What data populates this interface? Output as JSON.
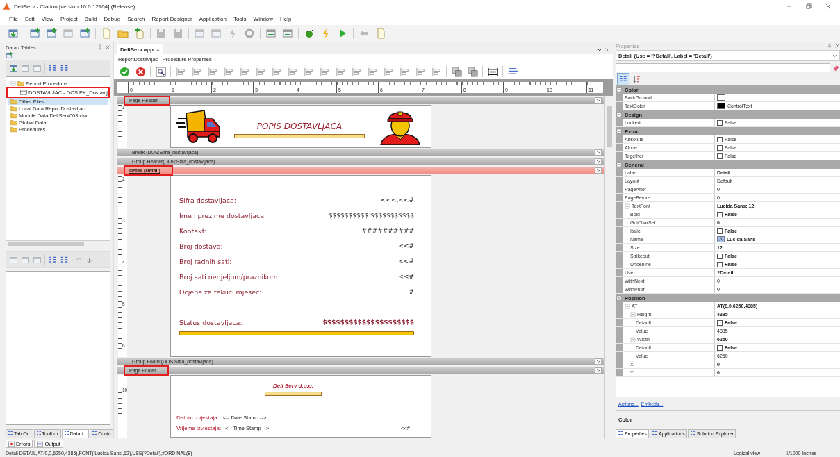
{
  "window": {
    "title": "DeliServ - Clarion [version 10.0.12104] (Release)"
  },
  "menu": [
    "File",
    "Edit",
    "View",
    "Project",
    "Build",
    "Debug",
    "Search",
    "Report Designer",
    "Application",
    "Tools",
    "Window",
    "Help"
  ],
  "data_panel": {
    "title": "Data / Tables",
    "tree": [
      {
        "label": "Report Procedure",
        "expanded": true,
        "selected": false,
        "highlighted": false,
        "children": [
          {
            "label": "DOSTAVLJAC - DOS:PK_Dostavlj",
            "selected": false,
            "highlighted": true
          }
        ]
      },
      {
        "label": "Other Files",
        "selected": true,
        "highlighted": false
      },
      {
        "label": "Local Data ReportDostavljac",
        "selected": false,
        "highlighted": false
      },
      {
        "label": "Module Data DeliServ003.clw",
        "selected": false,
        "highlighted": false
      },
      {
        "label": "Global Data",
        "selected": false,
        "highlighted": false
      },
      {
        "label": "Procedures",
        "selected": false,
        "highlighted": false
      }
    ],
    "tabs": [
      {
        "label": "Tab Or..",
        "selected": false
      },
      {
        "label": "Toolbox",
        "selected": false
      },
      {
        "label": "Data /...",
        "selected": true
      },
      {
        "label": "Contr...",
        "selected": false
      }
    ]
  },
  "document": {
    "tab": {
      "label": "DeliServ.app",
      "close": "×"
    },
    "subtitle": "ReportDostavljac - Procedure Properties",
    "ruler": [
      "0",
      "1",
      "2",
      "3",
      "4",
      "5",
      "6",
      "7",
      "8",
      "9",
      "10",
      "11"
    ],
    "sections": [
      {
        "band": {
          "label": "Page Header",
          "selected": false,
          "highlighted": true
        },
        "content": {
          "kind": "header",
          "ruler": [
            "1"
          ],
          "title": "POPIS DOSTAVLJACA"
        }
      },
      {
        "band": {
          "label": "Break (DOS:Sifra_dostavljaca)",
          "selected": false,
          "highlighted": false
        }
      },
      {
        "band": {
          "label": "Group Header(DOS:Sifra_dostavljaca)",
          "selected": false,
          "highlighted": false
        }
      },
      {
        "band": {
          "label": "Detail (Detail)",
          "selected": true,
          "highlighted": true
        },
        "content": {
          "kind": "detail",
          "ruler": [
            "2",
            "3",
            "4",
            "5",
            "6"
          ],
          "fields": [
            {
              "kind": "plain",
              "label": "Sifra dostavljaca:",
              "value": "<<<,<<#"
            },
            {
              "kind": "plain",
              "label": "Ime i prezime dostavljaca:",
              "value": "$$$$$$$$$$ $$$$$$$$$$$"
            },
            {
              "kind": "plain",
              "label": "Kontakt:",
              "value": "##########"
            },
            {
              "kind": "plain",
              "label": "Broj dostava:",
              "value": "<<#"
            },
            {
              "kind": "plain",
              "label": "Broj radnih sati:",
              "value": "<<#"
            },
            {
              "kind": "plain",
              "label": "Broj sati nedjeljom/praznikom:",
              "value": "<<#"
            },
            {
              "kind": "plain",
              "label": "Ocjena za tekuci mjesec:",
              "value": "#"
            },
            {
              "kind": "status",
              "label": "Status dostavljaca:",
              "value": "$$$$$$$$$$$$$$$$$$$$$"
            }
          ]
        }
      },
      {
        "band": {
          "label": "Group Footer(DOS:Sifra_dostavljaca)",
          "selected": false,
          "highlighted": false
        }
      },
      {
        "band": {
          "label": "Page Footer",
          "selected": false,
          "highlighted": true
        },
        "content": {
          "kind": "footer",
          "ruler": [
            "10"
          ],
          "company": "Deli Serv d.o.o.",
          "stamps": [
            {
              "label": "Datum izvjestaja:",
              "value": "<-- Date Stamp -->"
            },
            {
              "label": "Vrijeme izvjestaja:",
              "value": "<-- Time Stamp -->",
              "extra": "<<#"
            }
          ]
        }
      }
    ]
  },
  "properties": {
    "title": "Properties",
    "object": "Detail (Use = '?Detail', Label = 'Detail')",
    "categories": [
      {
        "name": "Color",
        "expanded": true,
        "rows": [
          {
            "name": "BackGround",
            "kind": "swatch",
            "color": "#ffffff"
          },
          {
            "name": "TextColor",
            "kind": "swatch",
            "color": "#000000",
            "value": "ControlText",
            "bold": false
          }
        ]
      },
      {
        "name": "Design",
        "expanded": true,
        "rows": [
          {
            "name": "Locked",
            "kind": "check",
            "checked": false,
            "value": "False",
            "bold": false
          }
        ]
      },
      {
        "name": "Extra",
        "expanded": true,
        "rows": [
          {
            "name": "Absolute",
            "kind": "check",
            "checked": false,
            "value": "False",
            "bold": false
          },
          {
            "name": "Alone",
            "kind": "check",
            "checked": false,
            "value": "False",
            "bold": false
          },
          {
            "name": "Together",
            "kind": "check",
            "checked": false,
            "value": "False",
            "bold": false
          }
        ]
      },
      {
        "name": "General",
        "expanded": true,
        "rows": [
          {
            "name": "Label",
            "kind": "text",
            "value": "Detail",
            "bold": true
          },
          {
            "name": "Layout",
            "kind": "text",
            "value": "Default",
            "bold": false
          },
          {
            "name": "PageAfter",
            "kind": "text",
            "value": "0",
            "bold": false
          },
          {
            "name": "PageBefore",
            "kind": "text",
            "value": "0",
            "bold": false
          },
          {
            "name": "TextFont",
            "kind": "text",
            "value": "Lucida Sans; 12",
            "bold": true,
            "expanded": true,
            "children": [
              {
                "name": "Bold",
                "kind": "check",
                "checked": false,
                "value": "False",
                "bold": true
              },
              {
                "name": "GdiCharSet",
                "kind": "text",
                "value": "0",
                "bold": true
              },
              {
                "name": "Italic",
                "kind": "check",
                "checked": false,
                "value": "False",
                "bold": true
              },
              {
                "name": "Name",
                "kind": "font",
                "value": "Lucida Sans",
                "bold": true
              },
              {
                "name": "Size",
                "kind": "text",
                "value": "12",
                "bold": true
              },
              {
                "name": "Strikeout",
                "kind": "check",
                "checked": false,
                "value": "False",
                "bold": true
              },
              {
                "name": "Underline",
                "kind": "check",
                "checked": false,
                "value": "False",
                "bold": true
              }
            ]
          },
          {
            "name": "Use",
            "kind": "text",
            "value": "?Detail",
            "bold": true
          },
          {
            "name": "WithNext",
            "kind": "text",
            "value": "0",
            "bold": false
          },
          {
            "name": "WithPrior",
            "kind": "text",
            "value": "0",
            "bold": false
          }
        ]
      },
      {
        "name": "Position",
        "expanded": true,
        "rows": [
          {
            "name": "AT",
            "kind": "text",
            "value": "AT(0,0,6250,4385)",
            "bold": true,
            "expanded": true,
            "children": [
              {
                "name": "Height",
                "kind": "text",
                "value": "4385",
                "bold": true,
                "expanded": true,
                "children": [
                  {
                    "name": "Default",
                    "kind": "check",
                    "checked": false,
                    "value": "False",
                    "bold": true
                  },
                  {
                    "name": "Value",
                    "kind": "text",
                    "value": "4385",
                    "bold": false
                  }
                ]
              },
              {
                "name": "Width",
                "kind": "text",
                "value": "6250",
                "bold": true,
                "expanded": true,
                "children": [
                  {
                    "name": "Default",
                    "kind": "check",
                    "checked": false,
                    "value": "False",
                    "bold": true
                  },
                  {
                    "name": "Value",
                    "kind": "text",
                    "value": "6250",
                    "bold": false
                  }
                ]
              },
              {
                "name": "X",
                "kind": "text",
                "value": "0",
                "bold": true
              },
              {
                "name": "Y",
                "kind": "text",
                "value": "0",
                "bold": true
              }
            ]
          }
        ]
      }
    ],
    "links": [
      "Actions...",
      "Embeds..."
    ],
    "description": "Color",
    "tabs": [
      {
        "label": "Properties",
        "selected": true
      },
      {
        "label": "Applications",
        "selected": false
      },
      {
        "label": "Solution Explorer",
        "selected": false
      }
    ]
  },
  "output_tabs": [
    {
      "label": "Errors"
    },
    {
      "label": "Output"
    }
  ],
  "status_bar": {
    "text": "Detail DETAIL,AT(0,0,6250,4385),FONT('Lucida Sans',12),USE(?Detail),#ORDINAL(8)",
    "view": "Logical view",
    "units": "1/1000 Inches"
  }
}
